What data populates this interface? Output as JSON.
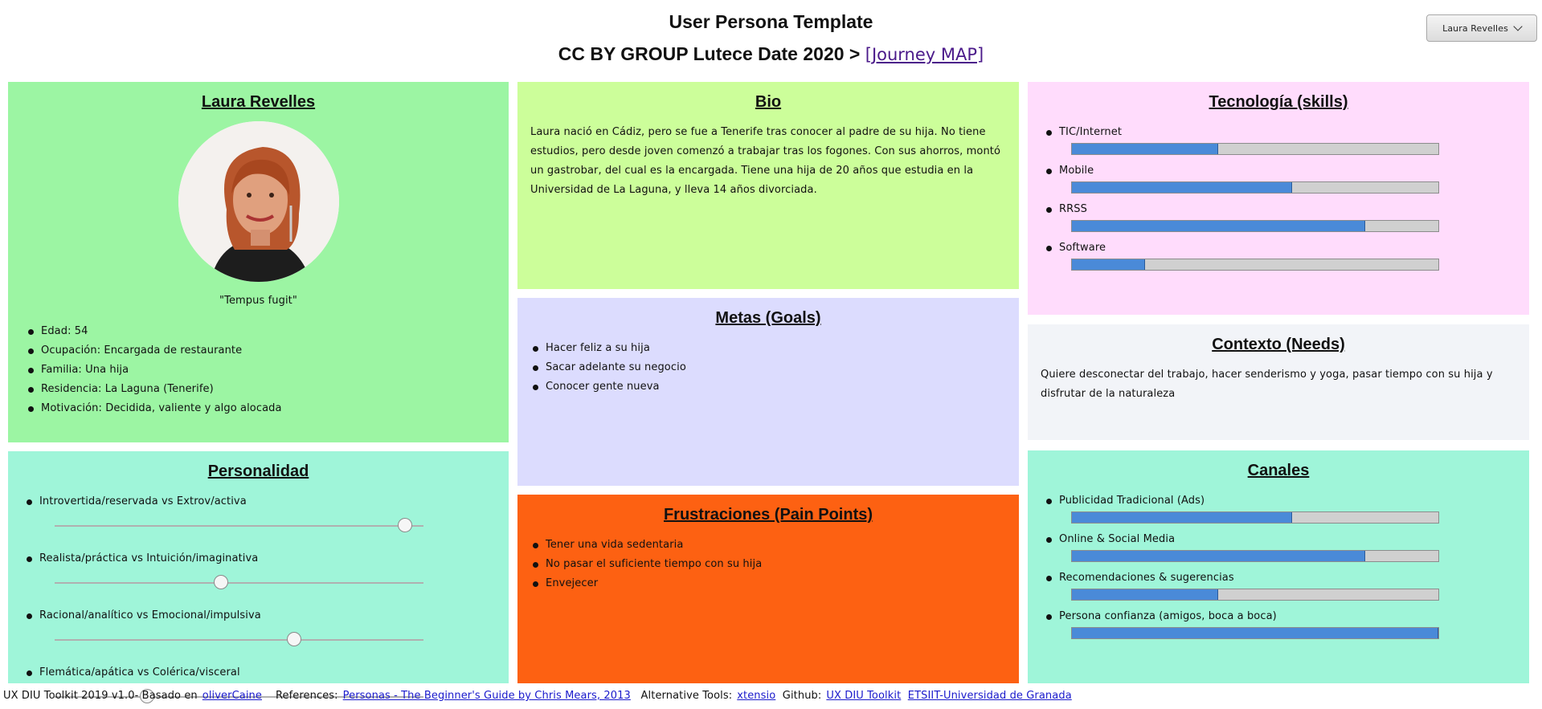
{
  "header": {
    "title": "User Persona Template",
    "subtitle_prefix": "CC BY GROUP Lutece Date 2020 >",
    "journey_link": "[Journey MAP]",
    "persona_selector": "Laura Revelles"
  },
  "persona": {
    "name": "Laura Revelles",
    "quote": "\"Tempus fugit\"",
    "facts": [
      "Edad: 54",
      "Ocupación: Encargada de restaurante",
      "Familia: Una hija",
      "Residencia: La Laguna (Tenerife)",
      "Motivación: Decidida, valiente y algo alocada"
    ]
  },
  "bio": {
    "title": "Bio",
    "text": "Laura nació en Cádiz, pero se fue a Tenerife tras conocer al padre de su hija. No tiene estudios, pero desde joven comenzó a trabajar tras los fogones. Con sus ahorros, montó un gastrobar, del cual es la encargada. Tiene una hija de 20 años que estudia en la Universidad de La Laguna, y lleva 14 años divorciada."
  },
  "tech": {
    "title": "Tecnología (skills)",
    "skills": [
      {
        "label": "TIC/Internet",
        "level": 0.4
      },
      {
        "label": "Mobile",
        "level": 0.6
      },
      {
        "label": "RRSS",
        "level": 0.8
      },
      {
        "label": "Software",
        "level": 0.2
      }
    ]
  },
  "goals": {
    "title": "Metas (Goals)",
    "items": [
      "Hacer feliz a su hija",
      "Sacar adelante su negocio",
      "Conocer gente nueva"
    ]
  },
  "context": {
    "title": "Contexto (Needs)",
    "text": "Quiere desconectar del trabajo, hacer senderismo y yoga, pasar tiempo con su hija y disfrutar de la naturaleza"
  },
  "personality": {
    "title": "Personalidad",
    "traits": [
      {
        "label": "Introvertida/reservada vs Extrov/activa",
        "value": 0.95
      },
      {
        "label": "Realista/práctica vs Intuición/imaginativa",
        "value": 0.45
      },
      {
        "label": "Racional/analítico vs Emocional/impulsiva",
        "value": 0.65
      },
      {
        "label": "Flemática/apática vs Colérica/visceral",
        "value": 0.25
      }
    ]
  },
  "frustrations": {
    "title": "Frustraciones (Pain Points)",
    "items": [
      "Tener una vida sedentaria",
      "No pasar el suficiente tiempo con su hija",
      "Envejecer"
    ]
  },
  "channels": {
    "title": "Canales",
    "items": [
      {
        "label": "Publicidad Tradicional (Ads)",
        "level": 0.6
      },
      {
        "label": "Online & Social Media",
        "level": 0.8
      },
      {
        "label": "Recomendaciones & sugerencias",
        "level": 0.4
      },
      {
        "label": "Persona confianza (amigos, boca a boca)",
        "level": 1.0
      }
    ]
  },
  "footer": {
    "credit": "UX DIU Toolkit 2019 v1.0- Basado en",
    "credit_link": "oliverCaine",
    "refs_label": "References:",
    "refs_link": "Personas - The Beginner's Guide by Chris Mears, 2013",
    "alt_label": "Alternative Tools:",
    "alt_link": "xtensio",
    "github_label": "Github:",
    "github_link": "UX DIU Toolkit",
    "univ_link": "ETSIIT-Universidad de Granada"
  },
  "colors": {
    "persona_bg": "#9cf5a3",
    "bio_bg": "#ccfe9a",
    "tech_bg": "#ffdcfc",
    "goals_bg": "#dcdcfe",
    "context_bg": "#f2f4f8",
    "personality_bg": "#9ff5d9",
    "frustrations_bg": "#fd6112",
    "channels_bg": "#9ff5d9",
    "bar_fill": "#4a8ad8"
  }
}
